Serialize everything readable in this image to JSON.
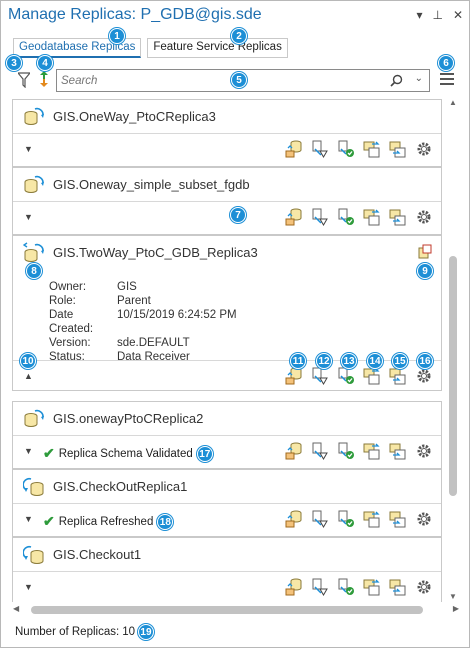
{
  "title": "Manage Replicas: P_GDB@gis.sde",
  "titlebar_icons": {
    "dropdown": "▾",
    "pin": "⊥",
    "close": "✕"
  },
  "tabs": [
    {
      "label": "Geodatabase Replicas",
      "active": true
    },
    {
      "label": "Feature Service Replicas",
      "active": false
    }
  ],
  "search": {
    "placeholder": "Search"
  },
  "callouts": [
    "1",
    "2",
    "3",
    "4",
    "5",
    "6",
    "7",
    "8",
    "9",
    "10",
    "11",
    "12",
    "13",
    "14",
    "15",
    "16",
    "17",
    "18",
    "19"
  ],
  "replicas": [
    {
      "name": "GIS.OneWay_PtoCReplica3",
      "status": ""
    },
    {
      "name": "GIS.Oneway_simple_subset_fgdb",
      "status": ""
    },
    {
      "name": "GIS.TwoWay_PtoC_GDB_Replica3",
      "status": "",
      "details": [
        {
          "label": "Owner:",
          "value": "GIS"
        },
        {
          "label": "Role:",
          "value": "Parent"
        },
        {
          "label": "Date Created:",
          "value": "10/15/2019 6:24:52 PM"
        },
        {
          "label": "Version:",
          "value": "sde.DEFAULT"
        },
        {
          "label": "Status:",
          "value": "Data Receiver"
        }
      ]
    },
    {
      "name": "GIS.onewayPtoCReplica2",
      "status": "Replica Schema Validated"
    },
    {
      "name": "GIS.CheckOutReplica1",
      "status": "Replica Refreshed"
    },
    {
      "name": "GIS.Checkout1",
      "status": ""
    }
  ],
  "action_icons": [
    "synchronize-icon",
    "export-acknowledgment-icon",
    "validate-schema-icon",
    "import-schema-icon",
    "export-changes-icon",
    "properties-gear-icon"
  ],
  "footer": {
    "label": "Number of Replicas:",
    "count": "10"
  },
  "colors": {
    "accent": "#1f6fb0",
    "badge": "#1d8fd6",
    "check": "#2e9b3b"
  }
}
